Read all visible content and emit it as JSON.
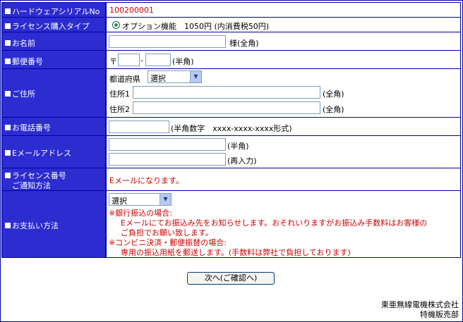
{
  "rows": {
    "serial": {
      "label": "ハードウェアシリアルNo",
      "value": "100200001"
    },
    "license_type": {
      "label": "ライセンス購入タイプ",
      "option": "オプション機能　1050円 (内消費税50円)"
    },
    "name": {
      "label": "お名前",
      "value": "",
      "suffix": "様(全角)"
    },
    "postal": {
      "label": "郵便番号",
      "prefix": "〒",
      "dash": "-",
      "suffix": "(半角)"
    },
    "address": {
      "label": "ご住所",
      "pref_label": "都道府県",
      "pref_selected": "選択",
      "addr1_label": "住所1",
      "addr2_label": "住所2",
      "suffix1": "(全角)",
      "suffix2": "(全角)"
    },
    "phone": {
      "label": "お電話番号",
      "hint": "(半角数字　xxxx-xxxx-xxxx形式)"
    },
    "email": {
      "label": "Eメールアドレス",
      "suffix1": "(半角)",
      "suffix2": "(再入力)"
    },
    "notify": {
      "label_line1": "ライセンス番号",
      "label_line2": "ご通知方法",
      "value": "Eメールになります。"
    },
    "payment": {
      "label": "お支払い方法",
      "selected": "選択",
      "note1_title": "※銀行振込の場合:",
      "note1_line1": "Eメールにてお振込み先をお知らせします。おそれいりますがお振込み手数料はお客様の",
      "note1_line2": "ご負担でお願い致します。",
      "note2_title": "※コンビニ決済・郵便振替の場合:",
      "note2_line1": "専用の振込用紙を郵送します。(手数料は弊社で負担しております)"
    }
  },
  "submit_label": "次へ(ご確認へ)",
  "footer": {
    "company": "東亜無線電機株式会社",
    "dept": "特機販売部"
  },
  "colors": {
    "label_bg": "#2c2cd0",
    "border": "#0000aa",
    "note_red": "#cc0000"
  }
}
